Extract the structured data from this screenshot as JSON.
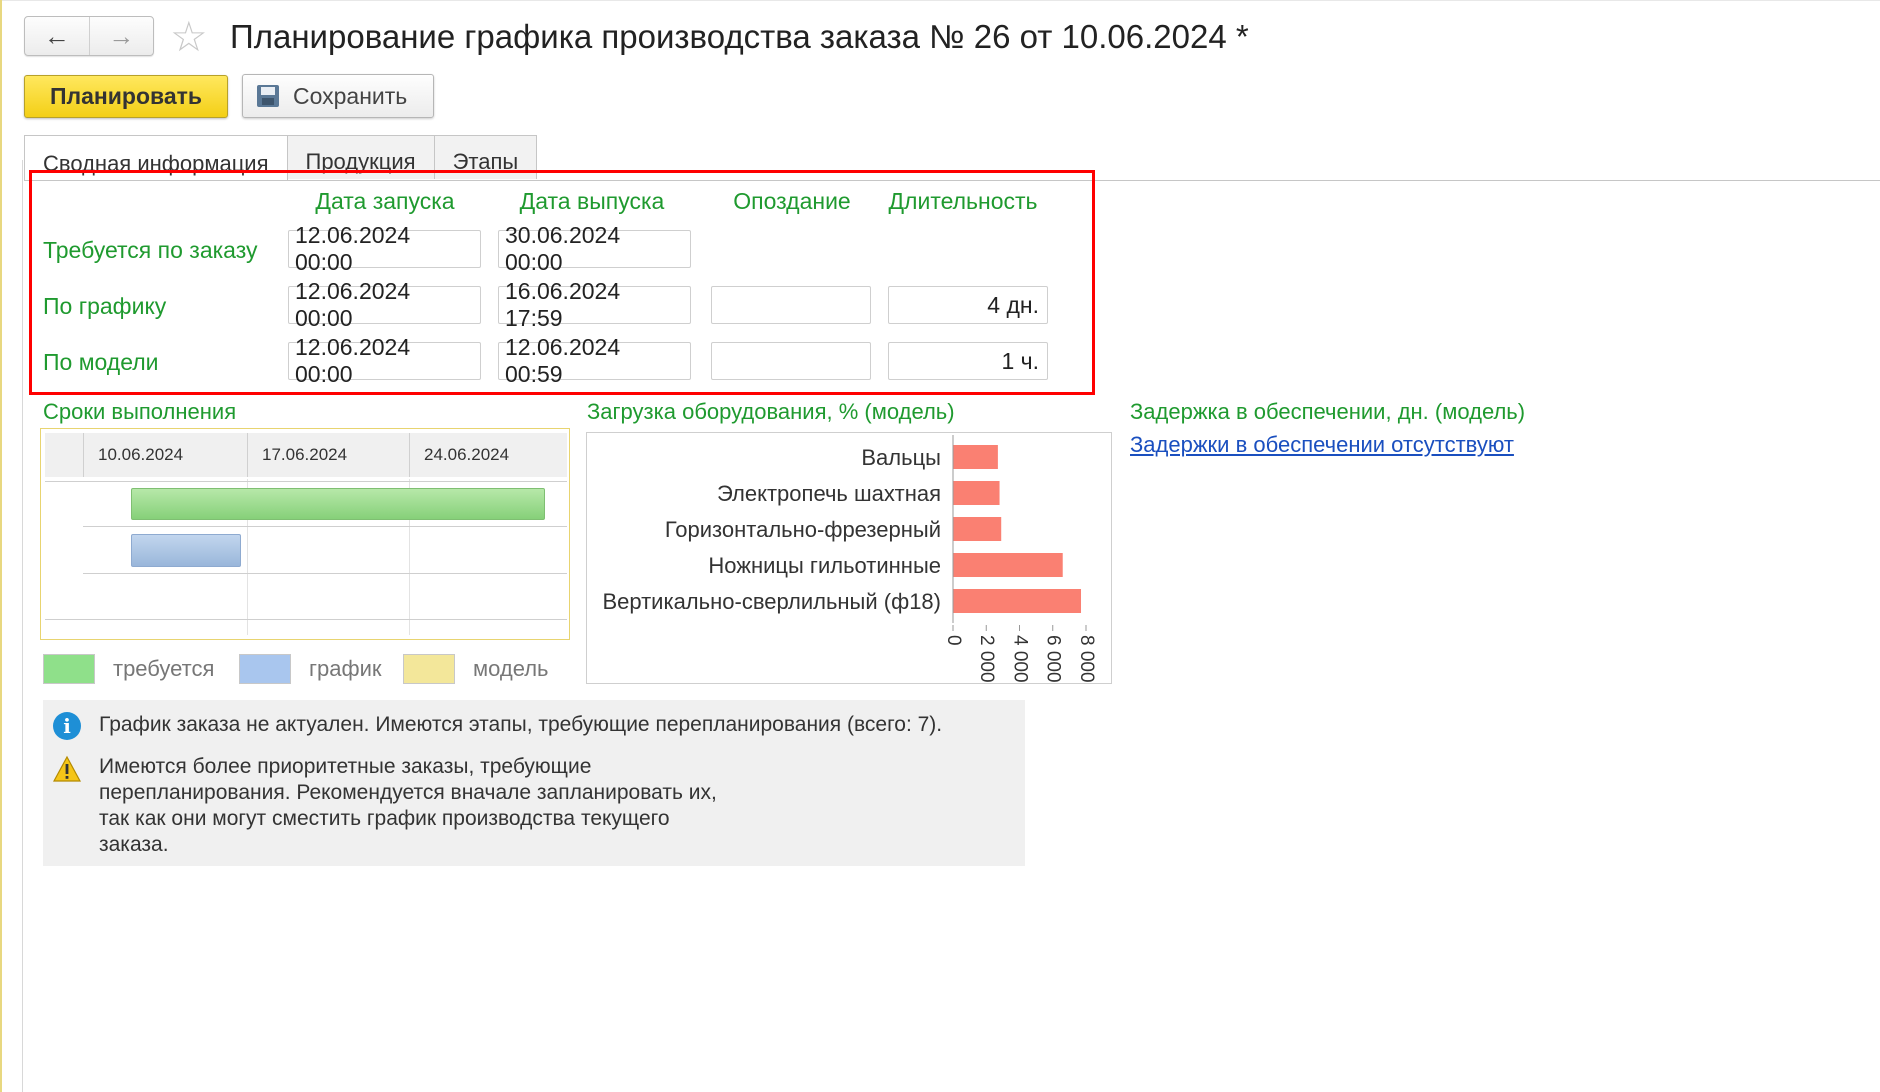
{
  "window": {
    "title": "Планирование графика производства заказа № 26 от 10.06.2024 *",
    "back_icon": "arrow-left-icon",
    "forward_icon": "arrow-right-icon",
    "favorite_icon": "star-icon"
  },
  "toolbar": {
    "plan_label": "Планировать",
    "save_label": "Сохранить",
    "save_icon": "floppy-disk-icon"
  },
  "tabs": [
    {
      "label": "Сводная информация",
      "active": true
    },
    {
      "label": "Продукция",
      "active": false
    },
    {
      "label": "Этапы",
      "active": false
    }
  ],
  "summary": {
    "columns": [
      "Дата запуска",
      "Дата выпуска",
      "Опоздание",
      "Длительность"
    ],
    "rows": [
      {
        "label": "Требуется по заказу",
        "start": "12.06.2024 00:00",
        "end": "30.06.2024 00:00",
        "delay": "",
        "duration": ""
      },
      {
        "label": "По графику",
        "start": "12.06.2024 00:00",
        "end": "16.06.2024 17:59",
        "delay": "",
        "duration": "4 дн."
      },
      {
        "label": "По модели",
        "start": "12.06.2024 00:00",
        "end": "12.06.2024 00:59",
        "delay": "",
        "duration": "1 ч."
      }
    ]
  },
  "terms": {
    "title": "Сроки выполнения",
    "dates": [
      "10.06.2024",
      "17.06.2024",
      "24.06.2024"
    ],
    "legend": [
      "требуется",
      "график",
      "модель"
    ]
  },
  "chart_data": {
    "type": "bar",
    "orientation": "horizontal",
    "title": "Загрузка оборудования, % (модель)",
    "categories": [
      "Вальцы",
      "Электропечь шахтная",
      "Горизонтально-фрезерный",
      "Ножницы гильотинные",
      "Вертикально-сверлильный (ф18)"
    ],
    "values": [
      2700,
      2800,
      2900,
      6600,
      7700
    ],
    "xticks": [
      "0",
      "2 000",
      "4 000",
      "6 000",
      "8 000"
    ],
    "xlim": [
      0,
      8000
    ],
    "color": "#fa8072"
  },
  "supply": {
    "title": "Задержка в обеспечении, дн. (модель)",
    "link": "Задержки в обеспечении отсутствуют"
  },
  "messages": {
    "info": "График заказа не актуален. Имеются этапы, требующие перепланирования (всего: 7).",
    "warning_lines": [
      "Имеются более приоритетные заказы, требующие",
      "перепланирования. Рекомендуется вначале запланировать их,",
      "так как они могут сместить график производства текущего",
      "заказа."
    ]
  },
  "colors": {
    "accent_green": "#1f9a2f",
    "highlight_red": "#ff0000",
    "legend_required": "#8fe08a",
    "legend_schedule": "#a9c6ee",
    "legend_model": "#f3e79a"
  }
}
